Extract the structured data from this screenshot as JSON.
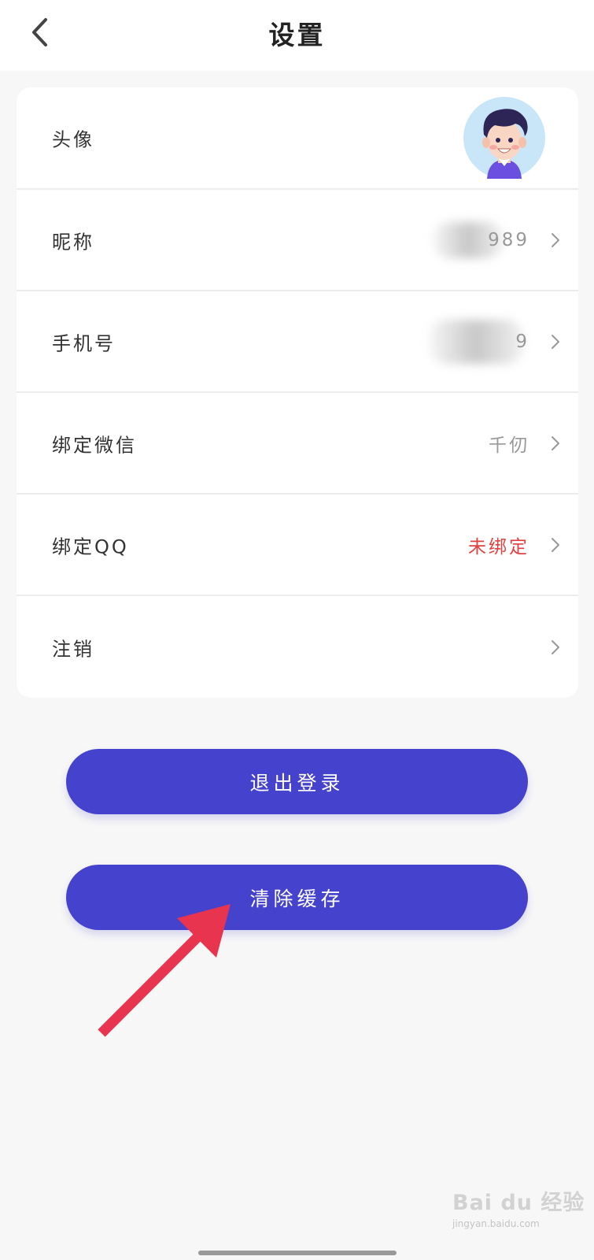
{
  "header": {
    "title": "设置"
  },
  "settings": {
    "avatar_label": "头像",
    "nickname_label": "昵称",
    "nickname_value": "989",
    "phone_label": "手机号",
    "phone_value": "9",
    "wechat_label": "绑定微信",
    "wechat_value": "千仞",
    "qq_label": "绑定QQ",
    "qq_value": "未绑定",
    "cancel_label": "注销"
  },
  "buttons": {
    "logout": "退出登录",
    "clear_cache": "清除缓存"
  },
  "watermark": {
    "text": "Bai du 经验",
    "url": "jingyan.baidu.com"
  },
  "colors": {
    "accent": "#4543cd",
    "unbound_red": "#e04040",
    "annotation_arrow": "#e8344e"
  }
}
